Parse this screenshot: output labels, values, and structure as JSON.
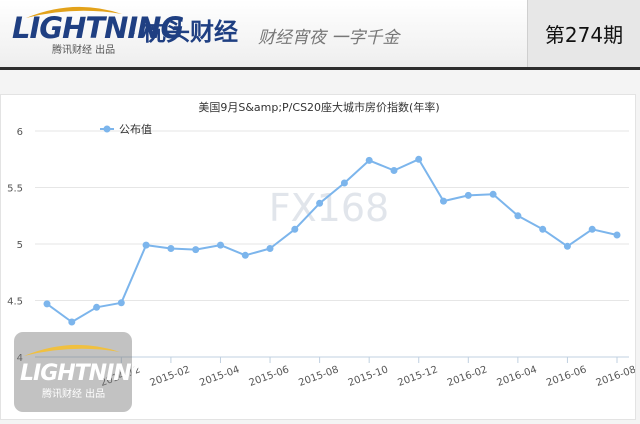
{
  "header": {
    "logo_text": "LIGHTNING",
    "logo_sub": "腾讯财经 出品",
    "brand_dot": "·",
    "brand_name": "枕头财经",
    "tagline": "财经宵夜 一字千金",
    "issue": "第274期"
  },
  "watermark": {
    "center_text": "FX168",
    "logo_text": "LIGHTNING",
    "logo_sub": "腾讯财经 出品"
  },
  "colors": {
    "brand": "#1f3f82",
    "series": "#7cb5ec",
    "grid": "#e6e6e6",
    "axis_text": "#555555"
  },
  "chart_data": {
    "type": "line",
    "title": "美国9月S&amp;P/CS20座大城市房价指数(年率)",
    "xlabel": "",
    "ylabel": "",
    "ylim": [
      4,
      6
    ],
    "yticks": [
      4,
      4.5,
      5,
      5.5,
      6
    ],
    "xticks": [
      {
        "label": "2014-12",
        "x": "2014-12"
      },
      {
        "label": "2015-02",
        "x": "2015-02"
      },
      {
        "label": "2015-04",
        "x": "2015-04"
      },
      {
        "label": "2015-06",
        "x": "2015-06"
      },
      {
        "label": "2015-08",
        "x": "2015-08"
      },
      {
        "label": "2015-10",
        "x": "2015-10"
      },
      {
        "label": "2015-12",
        "x": "2015-12"
      },
      {
        "label": "2016-02",
        "x": "2016-02"
      },
      {
        "label": "2016-04",
        "x": "2016-04"
      },
      {
        "label": "2016-06",
        "x": "2016-06"
      },
      {
        "label": "2016-08",
        "x": "2016-08"
      }
    ],
    "legend": {
      "placement": "top-left"
    },
    "grid": true,
    "series": [
      {
        "name": "公布值",
        "x": [
          "2014-09",
          "2014-10",
          "2014-11",
          "2014-12",
          "2015-01",
          "2015-02",
          "2015-03",
          "2015-04",
          "2015-05",
          "2015-06",
          "2015-07",
          "2015-08",
          "2015-09",
          "2015-10",
          "2015-11",
          "2015-12",
          "2016-01",
          "2016-02",
          "2016-03",
          "2016-04",
          "2016-05",
          "2016-06",
          "2016-07",
          "2016-08"
        ],
        "values": [
          4.47,
          4.31,
          4.44,
          4.48,
          4.99,
          4.96,
          4.95,
          4.99,
          4.9,
          4.96,
          5.13,
          5.36,
          5.54,
          5.74,
          5.65,
          5.75,
          5.38,
          5.43,
          5.44,
          5.25,
          5.13,
          4.98,
          5.13,
          5.08
        ]
      }
    ]
  }
}
